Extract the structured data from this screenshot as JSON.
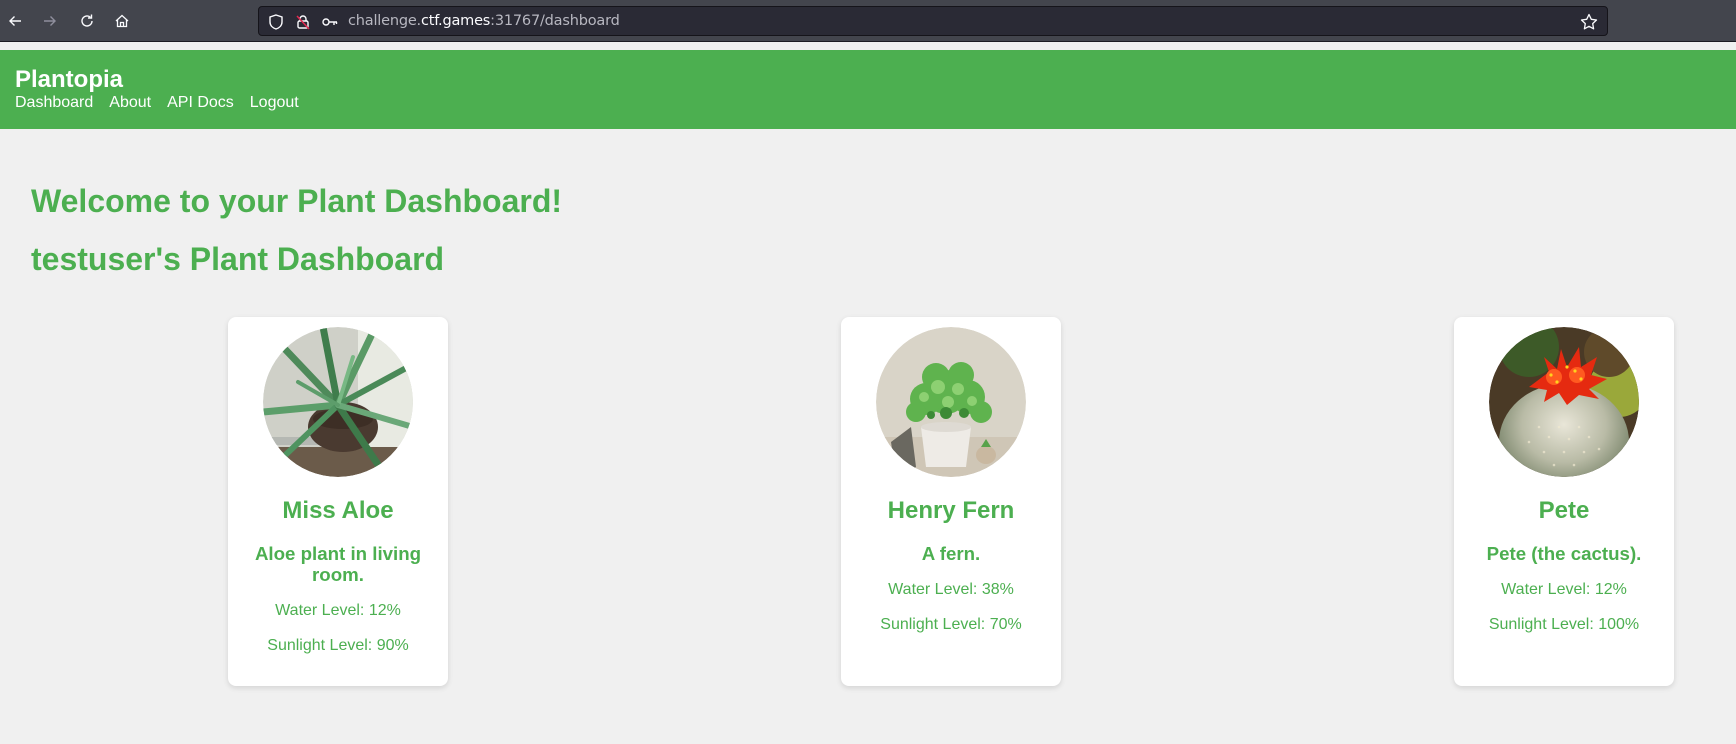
{
  "browser": {
    "url_prefix": "challenge.",
    "url_host": "ctf.games",
    "url_suffix": ":31767/dashboard"
  },
  "site": {
    "brand": "Plantopia",
    "nav": [
      {
        "label": "Dashboard"
      },
      {
        "label": "About"
      },
      {
        "label": "API Docs"
      },
      {
        "label": "Logout"
      }
    ]
  },
  "main": {
    "welcome_heading": "Welcome to your Plant Dashboard!",
    "user_heading": "testuser's Plant Dashboard",
    "plants": [
      {
        "name": "Miss Aloe",
        "description": "Aloe plant in living room.",
        "water_label": "Water Level: 12%",
        "sunlight_label": "Sunlight Level: 90%",
        "image": "aloe-plant-photo"
      },
      {
        "name": "Henry Fern",
        "description": "A fern.",
        "water_label": "Water Level: 38%",
        "sunlight_label": "Sunlight Level: 70%",
        "image": "fern-plant-photo"
      },
      {
        "name": "Pete",
        "description": "Pete (the cactus).",
        "water_label": "Water Level: 12%",
        "sunlight_label": "Sunlight Level: 100%",
        "image": "cactus-plant-photo"
      }
    ]
  },
  "colors": {
    "brand_green": "#4caf50",
    "page_background": "#f0f0f0",
    "card_background": "#ffffff"
  }
}
